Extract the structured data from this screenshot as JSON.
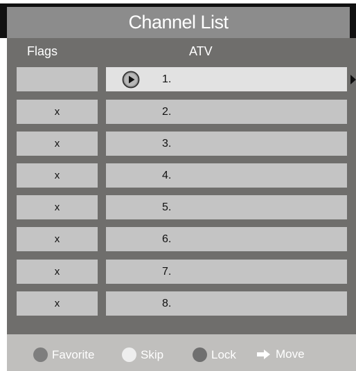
{
  "title": "Channel List",
  "headers": {
    "flags": "Flags",
    "atv": "ATV"
  },
  "rows": [
    {
      "flag": "",
      "number": "1.",
      "selected": true
    },
    {
      "flag": "x",
      "number": "2.",
      "selected": false
    },
    {
      "flag": "x",
      "number": "3.",
      "selected": false
    },
    {
      "flag": "x",
      "number": "4.",
      "selected": false
    },
    {
      "flag": "x",
      "number": "5.",
      "selected": false
    },
    {
      "flag": "x",
      "number": "6.",
      "selected": false
    },
    {
      "flag": "x",
      "number": "7.",
      "selected": false
    },
    {
      "flag": "x",
      "number": "8.",
      "selected": false
    }
  ],
  "legend": {
    "favorite": "Favorite",
    "skip": "Skip",
    "lock": "Lock",
    "move": "Move"
  },
  "icons": {
    "play": "play-icon",
    "scroll": "arrow-right-icon",
    "move": "arrow-right-icon"
  },
  "colors": {
    "title_bar": "#8c8c8c",
    "panel": "#6f6e6c",
    "cell": "#c4c4c4",
    "selected_cell": "#e2e2e2",
    "footer": "#c0bfbd"
  }
}
